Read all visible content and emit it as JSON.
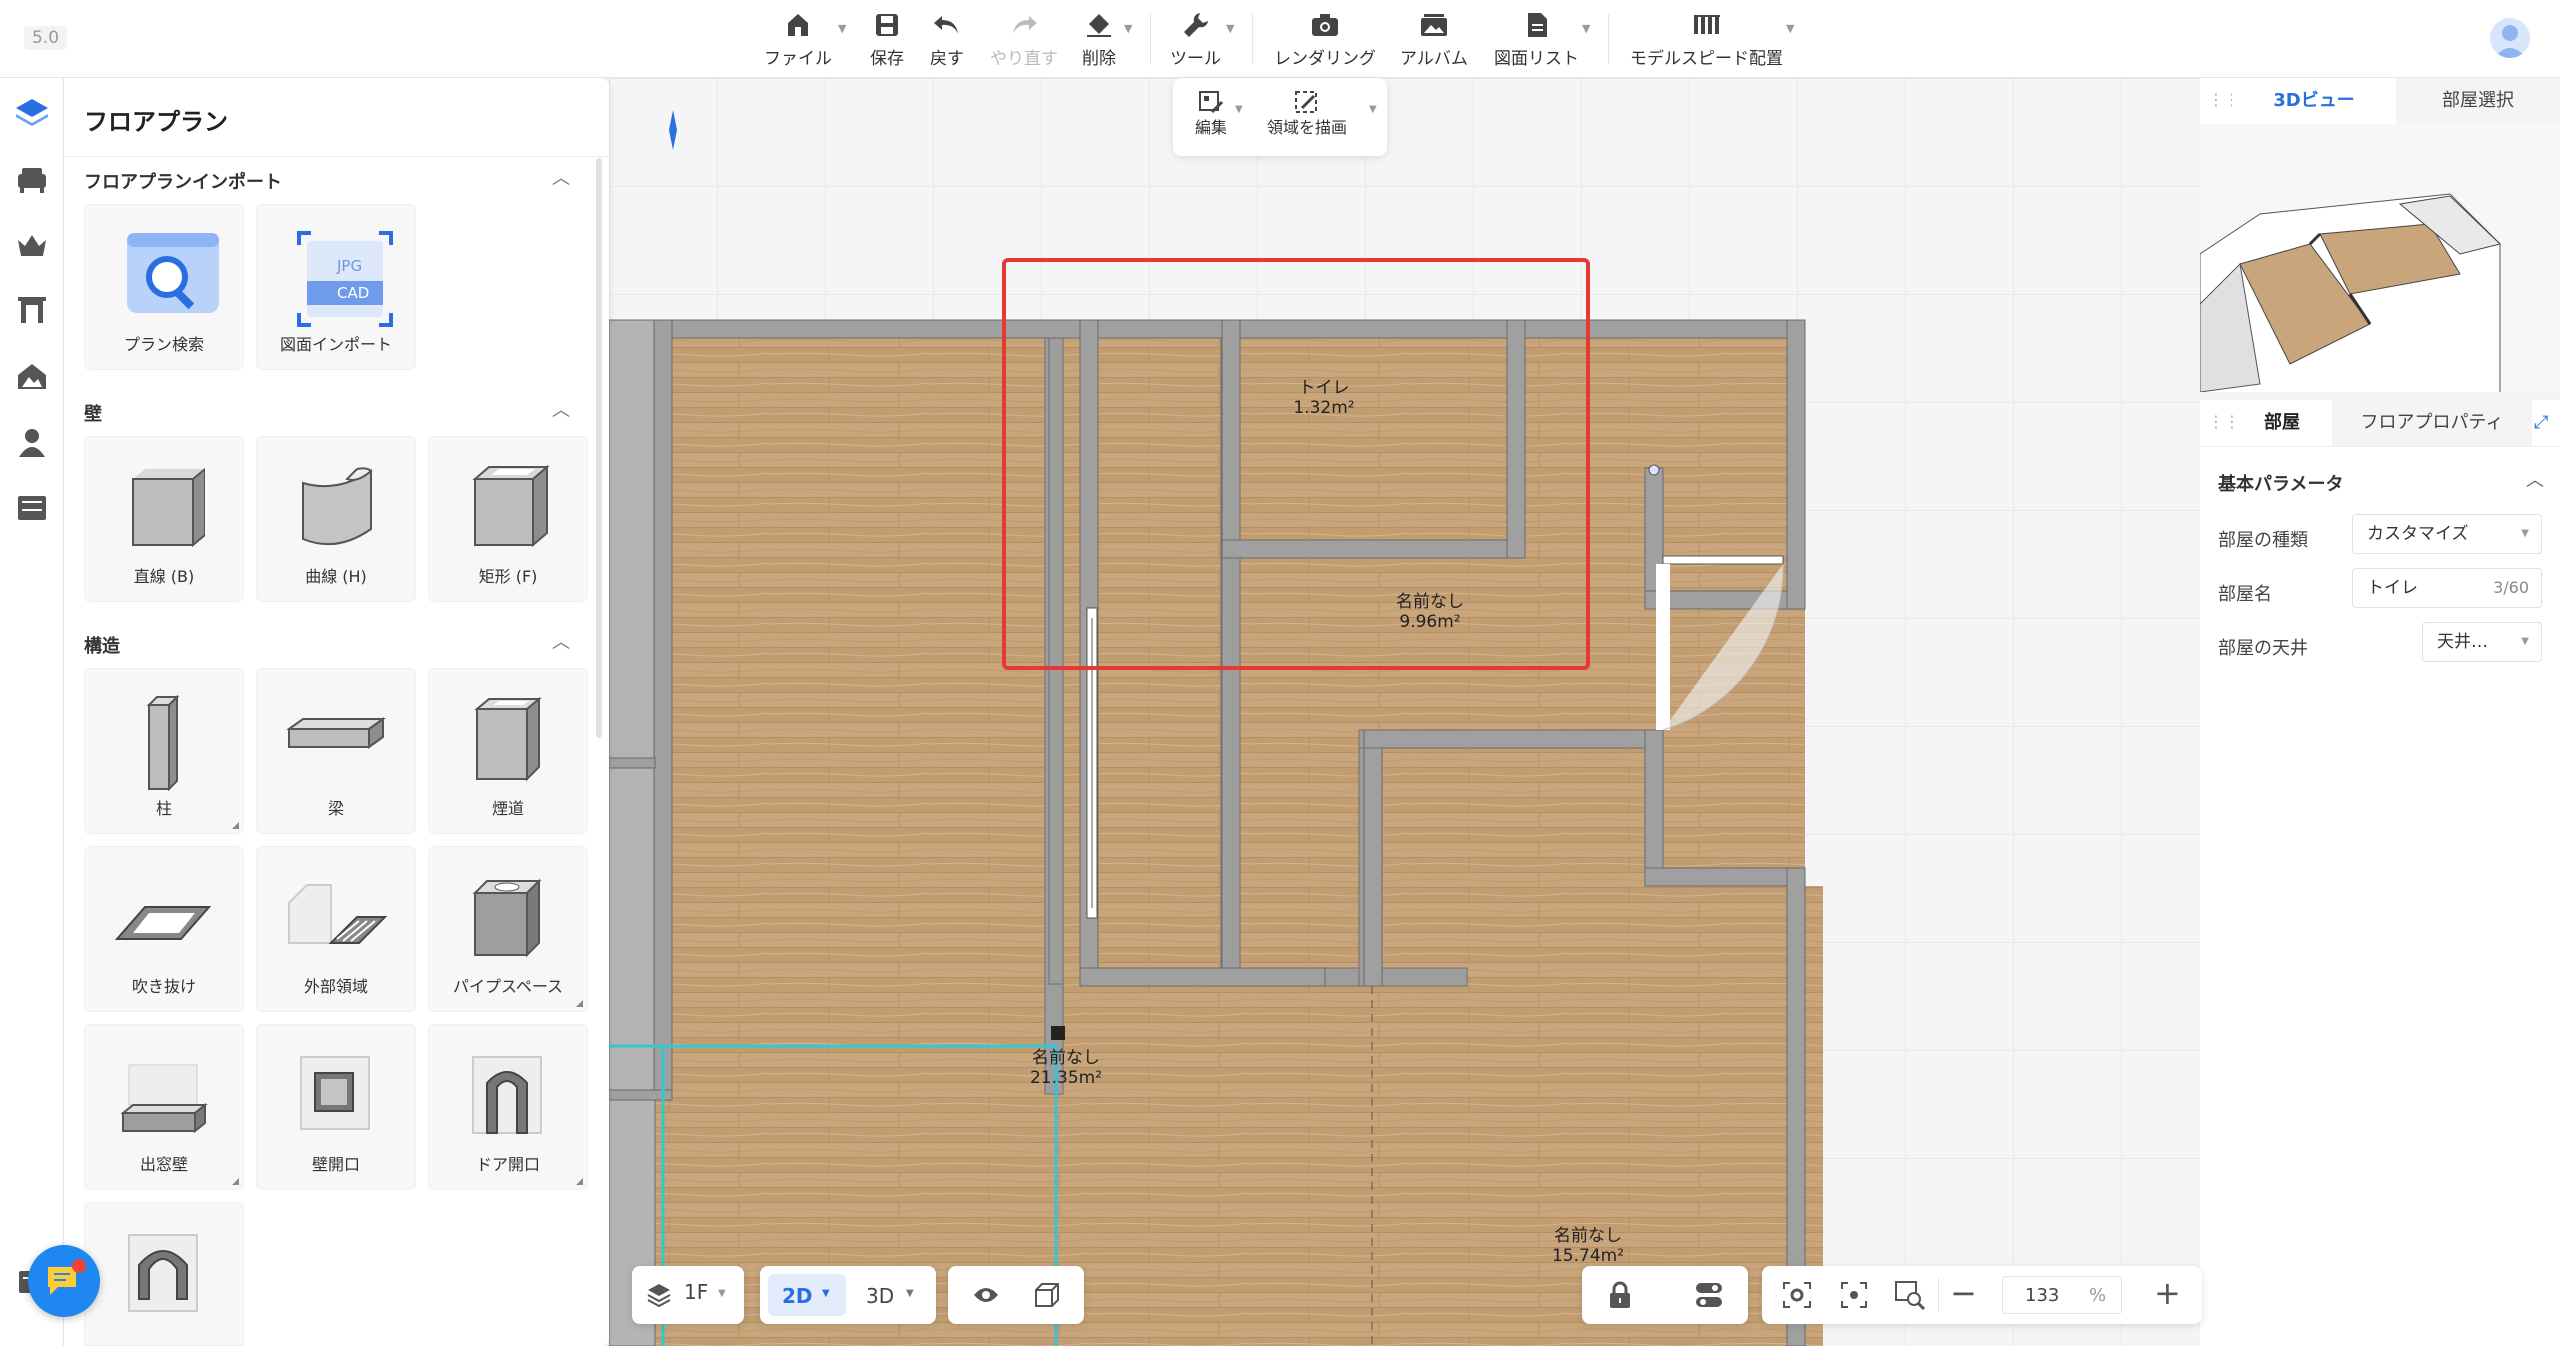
{
  "app": {
    "version": "5.0"
  },
  "toolbar": {
    "file": "ファイル",
    "save": "保存",
    "undo": "戻す",
    "redo": "やり直す",
    "delete": "削除",
    "tools": "ツール",
    "render": "レンダリング",
    "album": "アルバム",
    "drawings": "図面リスト",
    "model_speed": "モデルスピード配置"
  },
  "float_toolbar": {
    "edit": "編集",
    "draw_area": "領域を描画"
  },
  "left_panel": {
    "title": "フロアプラン",
    "sections": {
      "import": "フロアプランインポート",
      "walls": "壁",
      "structure": "構造"
    },
    "import_items": [
      "プラン検索",
      "図面インポート"
    ],
    "import_badges": {
      "jpg": "JPG",
      "cad": "CAD"
    },
    "wall_items": [
      "直線 (B)",
      "曲線 (H)",
      "矩形 (F)"
    ],
    "structure_items": [
      "柱",
      "梁",
      "煙道",
      "吹き抜け",
      "外部領域",
      "パイプスペース",
      "出窓壁",
      "壁開口",
      "ドア開口"
    ]
  },
  "rooms": [
    {
      "name": "トイレ",
      "area": "1.32m²"
    },
    {
      "name": "名前なし",
      "area": "9.96m²"
    },
    {
      "name": "名前なし",
      "area": "21.35m²"
    },
    {
      "name": "名前なし",
      "area": "15.74m²"
    }
  ],
  "right_panel": {
    "view_tabs": [
      "3Dビュー",
      "部屋選択"
    ],
    "prop_tabs": [
      "部屋",
      "フロアプロパティ"
    ],
    "section": "基本パラメータ",
    "fields": {
      "type_label": "部屋の種類",
      "type_value": "カスタマイズ",
      "name_label": "部屋名",
      "name_value": "トイレ",
      "name_count": "3/60",
      "ceiling_label": "部屋の天井",
      "ceiling_value": "天井…"
    }
  },
  "bottom": {
    "floor": "1F",
    "mode_2d": "2D",
    "mode_3d": "3D",
    "zoom": "133",
    "zoom_unit": "%"
  },
  "colors": {
    "accent": "#2a6fe0",
    "selection": "#e53935",
    "room_outline": "#35c7d0",
    "wall": "#9e9e9e",
    "floor": "#c9a57c"
  }
}
